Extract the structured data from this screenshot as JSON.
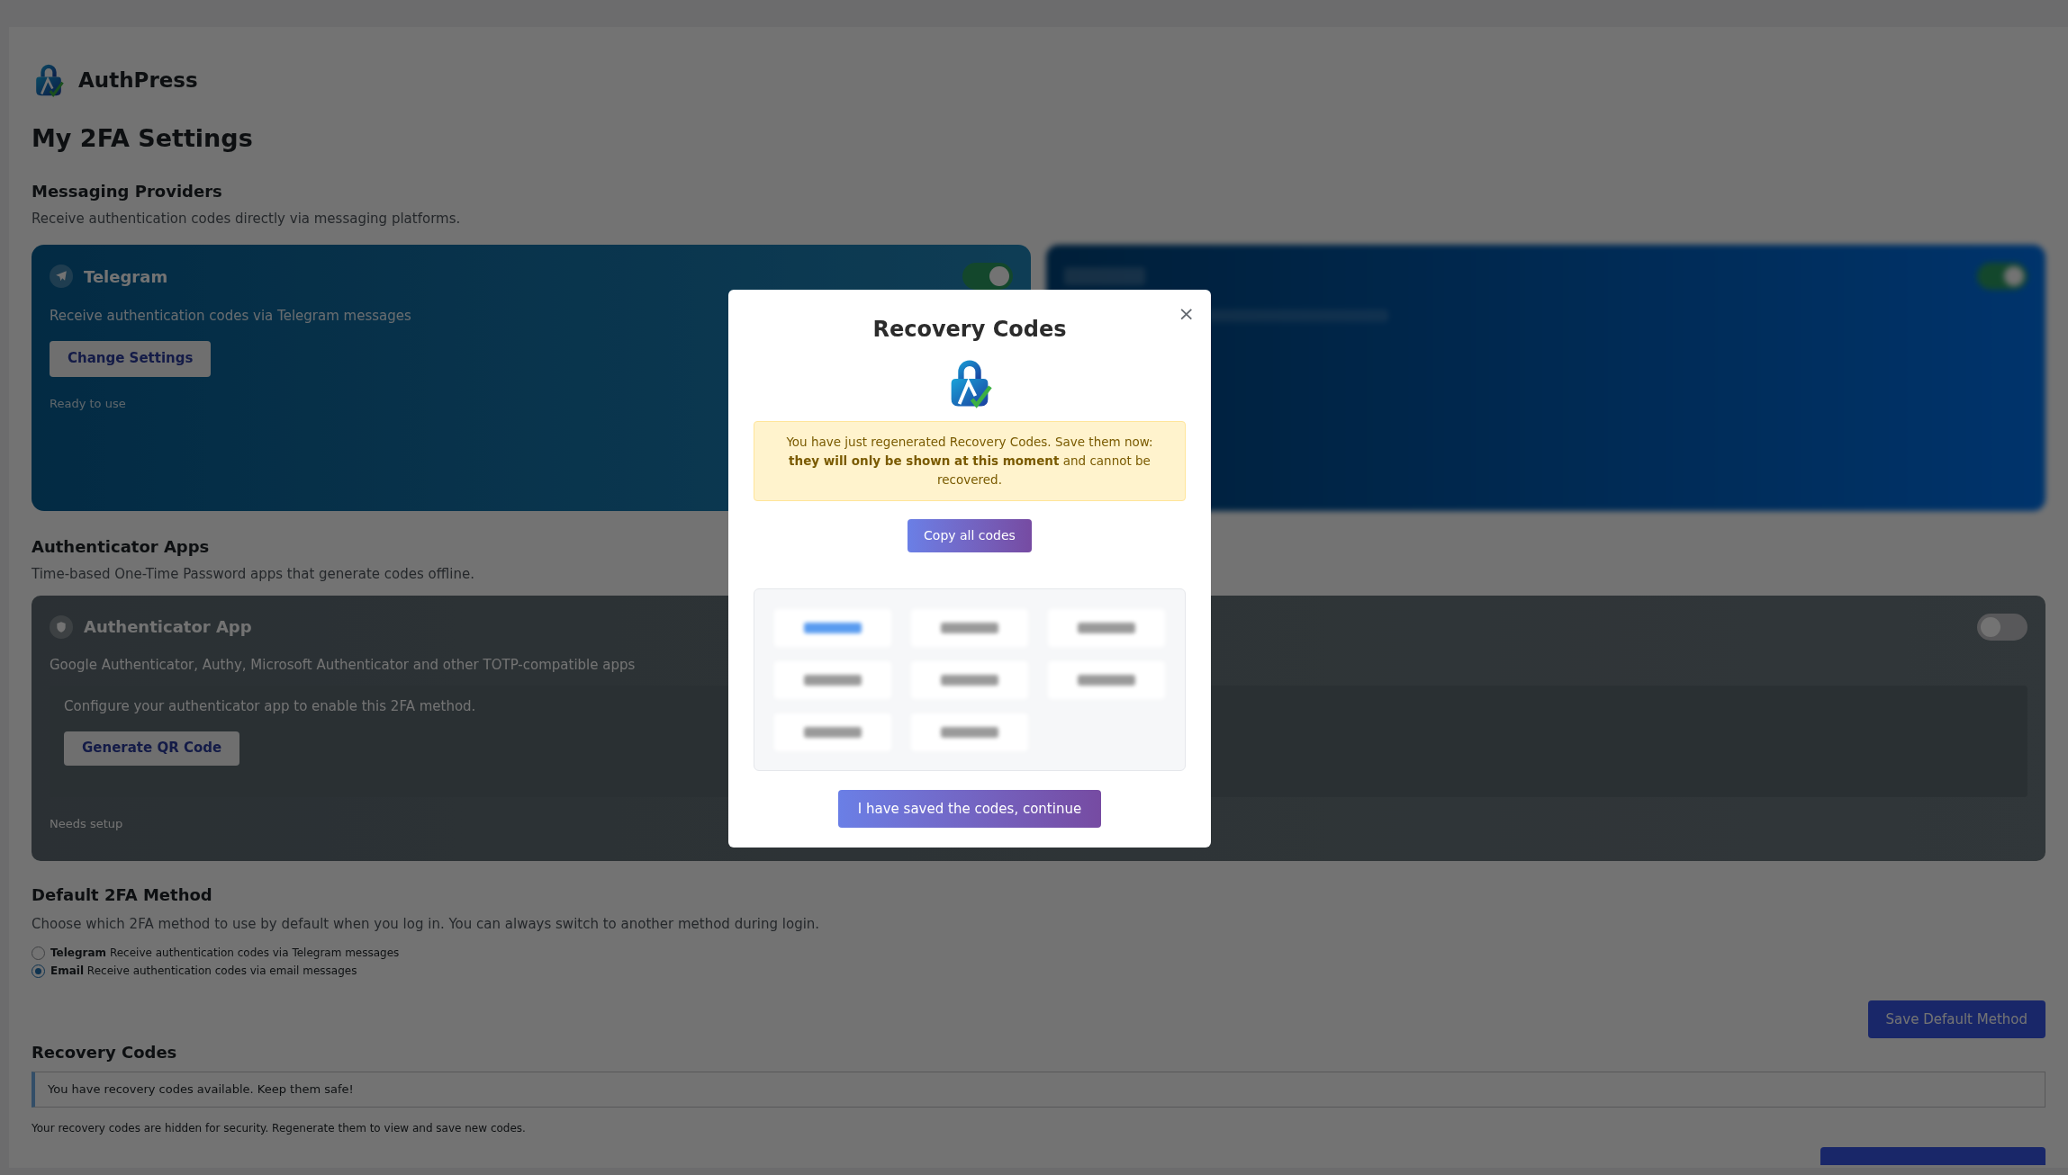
{
  "app": {
    "name": "AuthPress"
  },
  "page_title": "My 2FA Settings",
  "messaging": {
    "title": "Messaging Providers",
    "description": "Receive authentication codes directly via messaging platforms.",
    "telegram": {
      "name": "Telegram",
      "description": "Receive authentication codes via Telegram messages",
      "button": "Change Settings",
      "status": "Ready to use",
      "on": true
    },
    "email": {
      "on": true
    }
  },
  "authenticator": {
    "title": "Authenticator Apps",
    "description": "Time-based One-Time Password apps that generate codes offline.",
    "card": {
      "name": "Authenticator App",
      "description": "Google Authenticator, Authy, Microsoft Authenticator and other TOTP-compatible apps",
      "hint": "Configure your authenticator app to enable this 2FA method.",
      "button": "Generate QR Code",
      "status": "Needs setup",
      "on": false
    }
  },
  "default_method": {
    "title": "Default 2FA Method",
    "description": "Choose which 2FA method to use by default when you log in. You can always switch to another method during login.",
    "options": [
      {
        "label": "Telegram",
        "description": "Receive authentication codes via Telegram messages",
        "selected": false
      },
      {
        "label": "Email",
        "description": "Receive authentication codes via email messages",
        "selected": true
      }
    ],
    "save_button": "Save Default Method"
  },
  "recovery": {
    "title": "Recovery Codes",
    "notice": "You have recovery codes available. Keep them safe!",
    "note": "Your recovery codes are hidden for security. Regenerate them to view and save new codes."
  },
  "modal": {
    "title": "Recovery Codes",
    "close": "×",
    "warning": "You have just regenerated Recovery Codes. Save them now: **they will only be shown at this moment** and cannot be recovered.",
    "copy_button": "Copy all codes",
    "codes": [
      {
        "selected": true
      },
      {
        "selected": false
      },
      {
        "selected": false
      },
      {
        "selected": false
      },
      {
        "selected": false
      },
      {
        "selected": false
      },
      {
        "selected": false
      },
      {
        "selected": false
      }
    ],
    "continue_button": "I have saved the codes, continue"
  }
}
